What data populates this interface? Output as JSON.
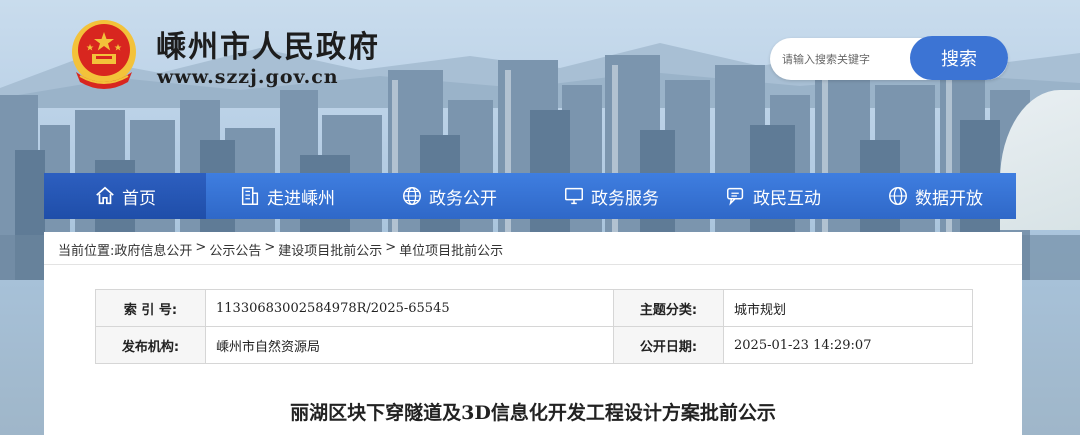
{
  "header": {
    "site_title": "嵊州市人民政府",
    "site_url": "www.szzj.gov.cn",
    "emblem_icon": "national-emblem-icon"
  },
  "search": {
    "placeholder": "请输入搜索关键字",
    "button_label": "搜索"
  },
  "nav": {
    "items": [
      {
        "label": "首页",
        "icon": "home-icon"
      },
      {
        "label": "走进嵊州",
        "icon": "building-icon"
      },
      {
        "label": "政务公开",
        "icon": "globe-icon"
      },
      {
        "label": "政务服务",
        "icon": "monitor-icon"
      },
      {
        "label": "政民互动",
        "icon": "chat-icon"
      },
      {
        "label": "数据开放",
        "icon": "globe-icon"
      }
    ]
  },
  "breadcrumb": {
    "prefix": "当前位置:",
    "items": [
      "政府信息公开",
      "公示公告",
      "建设项目批前公示",
      "单位项目批前公示"
    ],
    "separator": ">"
  },
  "meta": {
    "index_label": "索 引 号:",
    "index_value": "11330683002584978R/2025-65545",
    "topic_label": "主题分类:",
    "topic_value": "城市规划",
    "publisher_label": "发布机构:",
    "publisher_value": "嵊州市自然资源局",
    "date_label": "公开日期:",
    "date_value": "2025-01-23 14:29:07"
  },
  "document": {
    "title": "丽湖区块下穿隧道及3D信息化开发工程设计方案批前公示"
  },
  "colors": {
    "nav_blue": "#3f7ee0",
    "nav_active": "#1f4ea9",
    "search_button": "#3c74d4",
    "emblem_red": "#d8261f",
    "emblem_gold": "#f3c23a"
  }
}
